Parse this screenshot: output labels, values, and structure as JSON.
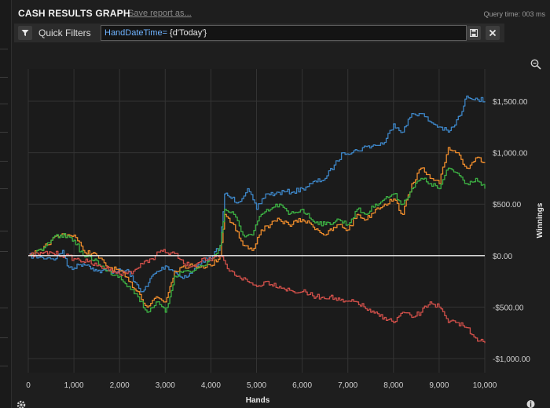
{
  "header": {
    "title": "CASH RESULTS GRAPH",
    "save_link": "Save report as...",
    "query_time": "Query time: 003 ms"
  },
  "filters": {
    "label": "Quick Filters",
    "query_field": "HandDateTime=",
    "query_value": " {d'Today'}",
    "icons": [
      "filter-icon",
      "save-icon",
      "close-icon"
    ]
  },
  "chart_data": {
    "type": "line",
    "xlabel": "Hands",
    "ylabel": "Winnings",
    "xlim": [
      0,
      10000
    ],
    "ylim": [
      -1000,
      1500
    ],
    "x_ticks": [
      "0",
      "1,000",
      "2,000",
      "3,000",
      "4,000",
      "5,000",
      "6,000",
      "7,000",
      "8,000",
      "9,000",
      "10,000"
    ],
    "y_ticks": [
      "$1,500.00",
      "$1,000.00",
      "$500.00",
      "$0.00",
      "-$500.00",
      "-$1,000.00"
    ],
    "grid": true,
    "colors": {
      "blue": "#3d85c6",
      "orange": "#ee8c2c",
      "green": "#3cb043",
      "red": "#d2504a",
      "zero_line": "#f0f0f0"
    },
    "series": [
      {
        "color": "#3d85c6",
        "x": [
          0,
          300,
          450,
          600,
          750,
          850,
          1000,
          1100,
          1200,
          1300,
          1400,
          1500,
          1800,
          2200,
          2300,
          2500,
          2600,
          2700,
          3000,
          3200,
          3300,
          3500,
          3600,
          3800,
          4000,
          4200,
          4300,
          4400,
          4600,
          4800,
          5000,
          5200,
          5400,
          5600,
          5800,
          6000,
          6200,
          6500,
          6700,
          6900,
          7200,
          7400,
          7600,
          7800,
          8000,
          8200,
          8400,
          8600,
          8800,
          9000,
          9200,
          9300,
          9500,
          9600,
          9800,
          10000
        ],
        "y": [
          0,
          -20,
          -20,
          -30,
          50,
          -100,
          -120,
          -90,
          -80,
          -90,
          -120,
          -150,
          -150,
          -150,
          -250,
          -350,
          -300,
          -200,
          -100,
          -150,
          -200,
          -200,
          -150,
          -50,
          -30,
          100,
          600,
          570,
          520,
          650,
          450,
          600,
          600,
          620,
          620,
          650,
          700,
          750,
          880,
          1000,
          1020,
          1060,
          1070,
          1100,
          1280,
          1200,
          1380,
          1380,
          1300,
          1250,
          1200,
          1250,
          1400,
          1550,
          1530,
          1500
        ]
      },
      {
        "color": "#ee8c2c",
        "x": [
          0,
          300,
          500,
          700,
          900,
          1000,
          1200,
          1500,
          1700,
          2000,
          2200,
          2400,
          2600,
          2800,
          3000,
          3100,
          3200,
          3400,
          3600,
          3800,
          4000,
          4200,
          4300,
          4500,
          4700,
          4900,
          5100,
          5300,
          5500,
          5700,
          6000,
          6200,
          6500,
          6800,
          7000,
          7200,
          7400,
          7600,
          7800,
          8000,
          8200,
          8400,
          8600,
          8800,
          9000,
          9200,
          9400,
          9600,
          9800,
          10000
        ],
        "y": [
          0,
          50,
          150,
          200,
          200,
          200,
          50,
          0,
          -100,
          -150,
          -250,
          -350,
          -500,
          -400,
          -450,
          -300,
          -150,
          -100,
          -100,
          -100,
          -100,
          0,
          400,
          300,
          100,
          50,
          250,
          300,
          350,
          300,
          350,
          300,
          200,
          300,
          250,
          400,
          350,
          450,
          500,
          550,
          400,
          700,
          850,
          750,
          700,
          1050,
          1000,
          850,
          950,
          900
        ]
      },
      {
        "color": "#3cb043",
        "x": [
          0,
          300,
          500,
          700,
          900,
          1000,
          1200,
          1500,
          1700,
          2000,
          2200,
          2400,
          2600,
          2800,
          3000,
          3100,
          3200,
          3400,
          3600,
          3800,
          4000,
          4200,
          4300,
          4500,
          4700,
          4900,
          5100,
          5300,
          5500,
          5700,
          6000,
          6200,
          6500,
          6800,
          7000,
          7200,
          7400,
          7600,
          7800,
          8000,
          8200,
          8400,
          8600,
          8800,
          9000,
          9200,
          9400,
          9600,
          9800,
          10000
        ],
        "y": [
          0,
          50,
          150,
          200,
          180,
          150,
          0,
          -50,
          -150,
          -200,
          -300,
          -400,
          -550,
          -450,
          -550,
          -400,
          -200,
          -150,
          -150,
          -100,
          -50,
          100,
          450,
          400,
          200,
          200,
          400,
          450,
          500,
          400,
          450,
          350,
          300,
          350,
          300,
          450,
          400,
          500,
          550,
          600,
          500,
          650,
          750,
          700,
          650,
          850,
          800,
          700,
          750,
          650
        ]
      },
      {
        "color": "#d2504a",
        "x": [
          0,
          300,
          500,
          800,
          1000,
          1300,
          1500,
          1800,
          2000,
          2300,
          2500,
          2700,
          2900,
          3000,
          3200,
          3400,
          3600,
          3800,
          4000,
          4200,
          4400,
          4600,
          4800,
          5000,
          5200,
          5500,
          5800,
          6000,
          6300,
          6600,
          6900,
          7200,
          7500,
          7800,
          8000,
          8200,
          8400,
          8600,
          8800,
          9000,
          9200,
          9400,
          9600,
          9800,
          10000
        ],
        "y": [
          0,
          20,
          30,
          0,
          -30,
          -60,
          -100,
          -130,
          -180,
          -150,
          -80,
          -30,
          50,
          30,
          20,
          -80,
          -100,
          -30,
          -50,
          0,
          -150,
          -200,
          -250,
          -300,
          -250,
          -300,
          -350,
          -350,
          -400,
          -400,
          -450,
          -450,
          -550,
          -600,
          -650,
          -550,
          -600,
          -550,
          -450,
          -500,
          -650,
          -650,
          -700,
          -800,
          -850
        ]
      }
    ]
  }
}
